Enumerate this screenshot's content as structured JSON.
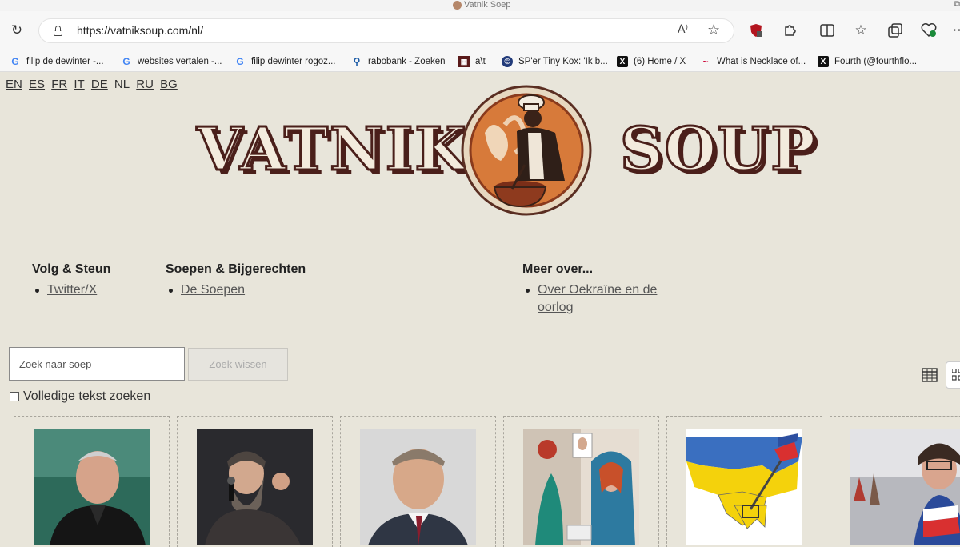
{
  "browser": {
    "window_title": "Vatnik Soep",
    "url": "https://vatniksoup.com/nl/",
    "bookmarks": [
      {
        "label": "filip de dewinter -...",
        "icon": "google-icon"
      },
      {
        "label": "websites vertalen -...",
        "icon": "google-icon"
      },
      {
        "label": "filip dewinter rogoz...",
        "icon": "google-icon"
      },
      {
        "label": "rabobank - Zoeken",
        "icon": "search-icon"
      },
      {
        "label": "a\\t",
        "icon": "site-icon"
      },
      {
        "label": "SP'er Tiny Kox: 'Ik b...",
        "icon": "news-icon"
      },
      {
        "label": "(6) Home / X",
        "icon": "x-icon"
      },
      {
        "label": "What is Necklace of...",
        "icon": "site-icon"
      },
      {
        "label": "Fourth (@fourthflo...",
        "icon": "x-icon"
      }
    ]
  },
  "page": {
    "languages": [
      "EN",
      "ES",
      "FR",
      "IT",
      "DE",
      "NL",
      "RU",
      "BG"
    ],
    "current_language": "NL",
    "logo": {
      "left": "VATNIK",
      "right": "SOUP"
    },
    "nav": [
      {
        "heading": "Volg & Steun",
        "links": [
          "Twitter/X"
        ]
      },
      {
        "heading": "Soepen & Bijgerechten",
        "links": [
          "De Soepen"
        ]
      },
      {
        "heading": "Meer over...",
        "links": [
          "Over Oekraïne en de oorlog"
        ]
      }
    ],
    "search": {
      "placeholder": "Zoek naar soep",
      "clear_label": "Zoek wissen",
      "fulltext_label": "Volledige tekst zoeken"
    },
    "colors": {
      "background": "#e8e5da",
      "logo_text": "#4a1f1a"
    }
  }
}
